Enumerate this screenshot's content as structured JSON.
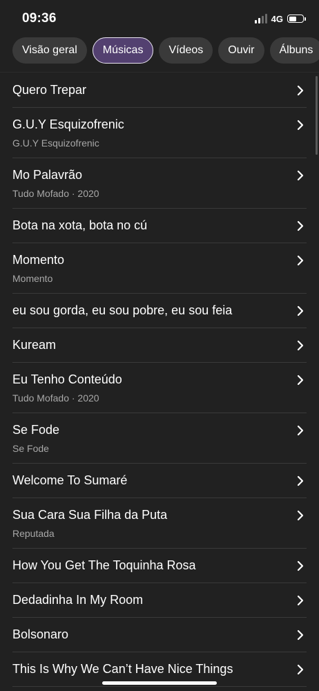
{
  "status": {
    "time": "09:36",
    "network": "4G"
  },
  "tabs": [
    {
      "label": "Visão geral",
      "active": false
    },
    {
      "label": "Músicas",
      "active": true
    },
    {
      "label": "Vídeos",
      "active": false
    },
    {
      "label": "Ouvir",
      "active": false
    },
    {
      "label": "Álbuns",
      "active": false
    }
  ],
  "songs": [
    {
      "title": "Quero Trepar",
      "subtitle": ""
    },
    {
      "title": "G.U.Y Esquizofrenic",
      "subtitle": "G.U.Y Esquizofrenic"
    },
    {
      "title": "Mo Palavrão",
      "subtitle": "Tudo Mofado · 2020"
    },
    {
      "title": "Bota na xota, bota no cú",
      "subtitle": ""
    },
    {
      "title": "Momento",
      "subtitle": "Momento"
    },
    {
      "title": "eu sou gorda, eu sou pobre, eu sou feia",
      "subtitle": ""
    },
    {
      "title": "Kuream",
      "subtitle": ""
    },
    {
      "title": "Eu Tenho Conteúdo",
      "subtitle": "Tudo Mofado · 2020"
    },
    {
      "title": "Se Fode",
      "subtitle": "Se Fode"
    },
    {
      "title": "Welcome To Sumaré",
      "subtitle": ""
    },
    {
      "title": "Sua Cara Sua Filha da Puta",
      "subtitle": "Reputada"
    },
    {
      "title": "How You Get The Toquinha Rosa",
      "subtitle": ""
    },
    {
      "title": "Dedadinha In My Room",
      "subtitle": ""
    },
    {
      "title": "Bolsonaro",
      "subtitle": ""
    },
    {
      "title": "This Is Why We Can’t Have Nice Things",
      "subtitle": ""
    }
  ],
  "icons": {
    "row_action": "chevron-right-icon",
    "signal": "signal-strength-icon",
    "battery": "battery-icon"
  },
  "colors": {
    "background": "#212121",
    "active_tab": "#534070",
    "inactive_tab": "#3a3a3a",
    "subtitle_text": "#a8a8a8"
  }
}
